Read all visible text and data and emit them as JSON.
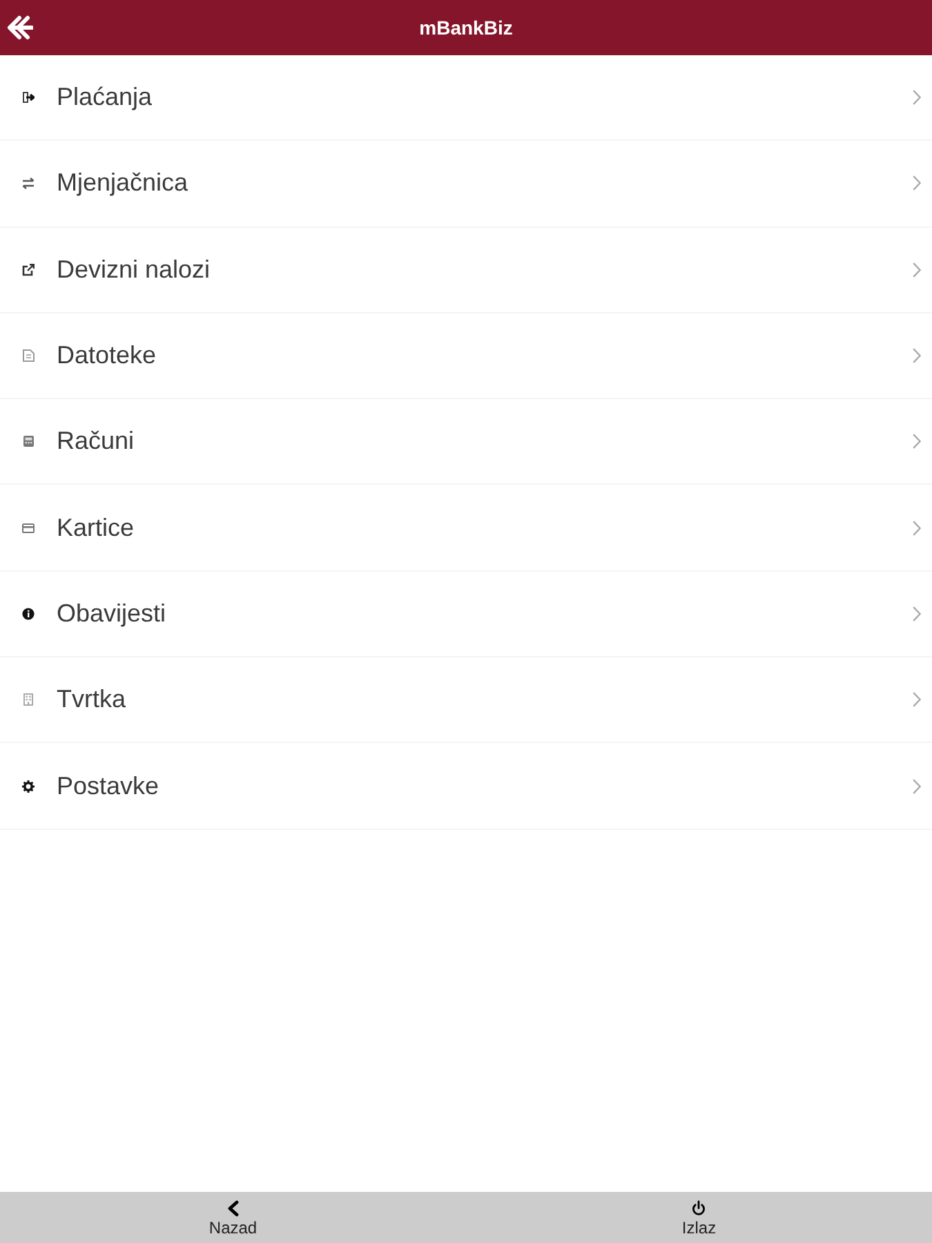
{
  "header": {
    "title": "mBankBiz"
  },
  "menu": [
    {
      "label": "Plaćanja"
    },
    {
      "label": "Mjenjačnica"
    },
    {
      "label": "Devizni nalozi"
    },
    {
      "label": "Datoteke"
    },
    {
      "label": "Računi"
    },
    {
      "label": "Kartice"
    },
    {
      "label": "Obavijesti"
    },
    {
      "label": "Tvrtka"
    },
    {
      "label": "Postavke"
    }
  ],
  "footer": [
    {
      "label": "Nazad",
      "kind": "back"
    },
    {
      "label": "Izlaz",
      "kind": "exit"
    }
  ]
}
